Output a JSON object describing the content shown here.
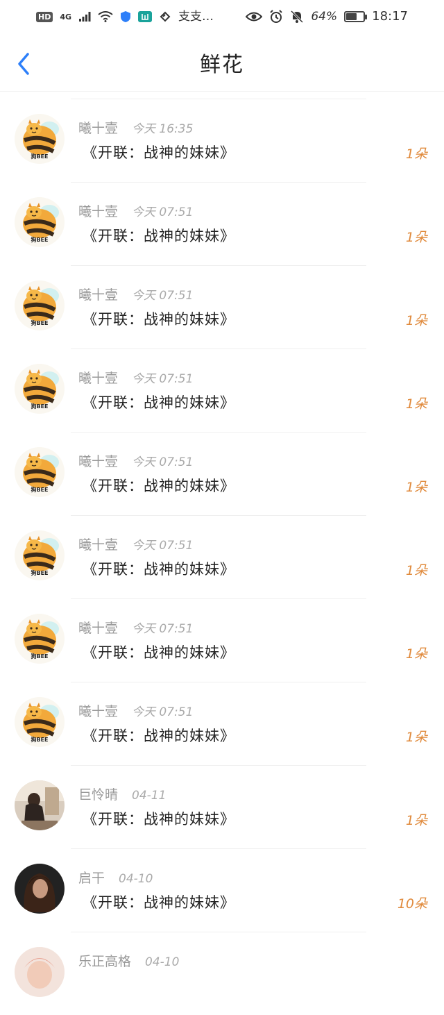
{
  "status_bar": {
    "hd": "HD",
    "network": "4G",
    "text_icons": "支支…",
    "battery_pct_text": "64%",
    "battery_level": 0.64,
    "time": "18:17"
  },
  "header": {
    "title": "鲜花",
    "back_icon": "chevron-left-icon"
  },
  "avatar_label": "狗BEE",
  "items": [
    {
      "user": "曦十壹",
      "time": "今天 16:35",
      "book": "《开联：战神的妹妹》",
      "count": "1朵",
      "avatar": "bee"
    },
    {
      "user": "曦十壹",
      "time": "今天 07:51",
      "book": "《开联：战神的妹妹》",
      "count": "1朵",
      "avatar": "bee"
    },
    {
      "user": "曦十壹",
      "time": "今天 07:51",
      "book": "《开联：战神的妹妹》",
      "count": "1朵",
      "avatar": "bee"
    },
    {
      "user": "曦十壹",
      "time": "今天 07:51",
      "book": "《开联：战神的妹妹》",
      "count": "1朵",
      "avatar": "bee"
    },
    {
      "user": "曦十壹",
      "time": "今天 07:51",
      "book": "《开联：战神的妹妹》",
      "count": "1朵",
      "avatar": "bee"
    },
    {
      "user": "曦十壹",
      "time": "今天 07:51",
      "book": "《开联：战神的妹妹》",
      "count": "1朵",
      "avatar": "bee"
    },
    {
      "user": "曦十壹",
      "time": "今天 07:51",
      "book": "《开联：战神的妹妹》",
      "count": "1朵",
      "avatar": "bee"
    },
    {
      "user": "曦十壹",
      "time": "今天 07:51",
      "book": "《开联：战神的妹妹》",
      "count": "1朵",
      "avatar": "bee"
    },
    {
      "user": "巨怜晴",
      "time": "04-11",
      "book": "《开联：战神的妹妹》",
      "count": "1朵",
      "avatar": "photo-sitting"
    },
    {
      "user": "启干",
      "time": "04-10",
      "book": "《开联：战神的妹妹》",
      "count": "10朵",
      "avatar": "photo-dark"
    },
    {
      "user": "乐正高格",
      "time": "04-10",
      "book": "",
      "count": "",
      "avatar": "photo-light"
    }
  ],
  "colors": {
    "accent_blue": "#2d7ff9",
    "flower_orange": "#e08a3c",
    "meta_gray": "#999999"
  }
}
